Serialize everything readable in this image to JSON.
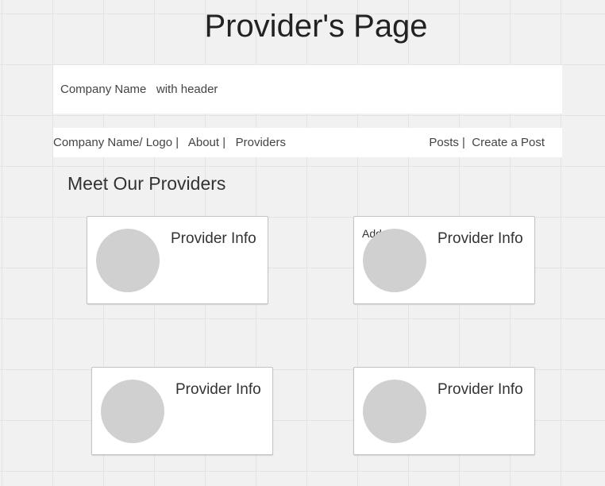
{
  "page": {
    "title": "Provider's Page",
    "background": "#f1f1f1"
  },
  "header": {
    "text": "Company Name   with header"
  },
  "nav": {
    "brand": "Company Name/ Logo",
    "sep1": " |   ",
    "about": "About",
    "sep2": " |   ",
    "providers": "Providers",
    "posts": "Posts",
    "sep3": " |  ",
    "create_post": "Create a Post"
  },
  "section": {
    "heading": "Meet Our Providers"
  },
  "cards": [
    {
      "title": "Provider Info",
      "note": ""
    },
    {
      "title": "Provider Info",
      "note": "Add"
    },
    {
      "title": "Provider Info",
      "note": ""
    },
    {
      "title": "Provider Info",
      "note": ""
    }
  ]
}
